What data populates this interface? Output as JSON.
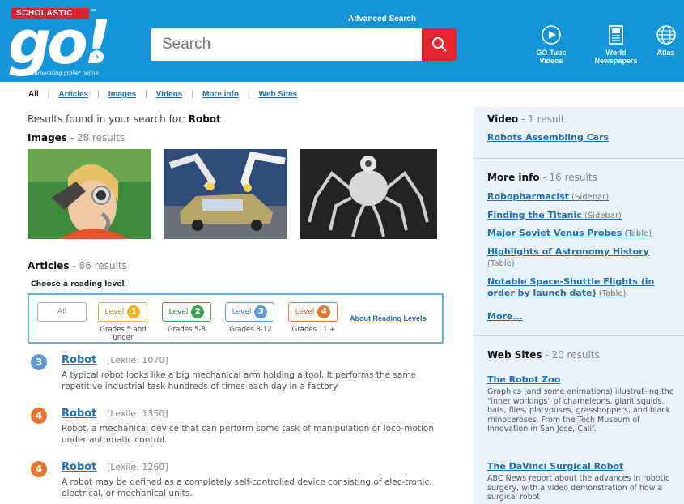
{
  "header": {
    "brand": "SCHOLASTIC",
    "logo": "go!",
    "tagline": "incorporating grolier online",
    "advanced_search": "Advanced Search",
    "search_placeholder": "Search",
    "tools": [
      {
        "icon": "play-circle-icon",
        "label_line1": "GO Tube",
        "label_line2": "Videos"
      },
      {
        "icon": "newspaper-icon",
        "label_line1": "World",
        "label_line2": "Newspapers"
      },
      {
        "icon": "globe-icon",
        "label_line1": "Atlas",
        "label_line2": ""
      }
    ]
  },
  "filters": [
    "All",
    "Articles",
    "Images",
    "Videos",
    "More info",
    "Web Sites"
  ],
  "results": {
    "prefix": "Results found in your search for: ",
    "query": "Robot"
  },
  "images": {
    "heading": "Images",
    "count": " - 28 results"
  },
  "articles": {
    "heading": "Articles",
    "count": " - 86 results",
    "choose_level": "Choose a reading level",
    "all_label": "All",
    "levels": [
      {
        "label": "Level",
        "num": "1",
        "grades": "Grades 5 and under",
        "color": "#f0b21f"
      },
      {
        "label": "Level",
        "num": "2",
        "grades": "Grades 5-8",
        "color": "#3aa548"
      },
      {
        "label": "Level",
        "num": "3",
        "grades": "Grades 8-12",
        "color": "#5b9ad6"
      },
      {
        "label": "Level",
        "num": "4",
        "grades": "Grades 11 +",
        "color": "#e6772d"
      }
    ],
    "about_levels": "About Reading Levels",
    "items": [
      {
        "level": "3",
        "color": "#5b9ad6",
        "title": "Robot",
        "lexile": "[Lexile: 1070]",
        "desc": "A typical robot looks like a big mechanical arm holding a tool. It performs the same repetitive industrial task hundreds of times each day in a factory."
      },
      {
        "level": "4",
        "color": "#e6772d",
        "title": "Robot",
        "lexile": "[Lexile: 1350]",
        "desc": "Robot, a mechanical device that can perform some task of manipulation or loco-motion under automatic control."
      },
      {
        "level": "4",
        "color": "#e6772d",
        "title": "Robot",
        "lexile": "[Lexile: 1260]",
        "desc": "A robot may be defined as a completely self-controlled device consisting of elec-tronic, electrical, or mechanical units."
      }
    ]
  },
  "sidebar": {
    "video": {
      "heading": "Video",
      "count": " - 1 result",
      "items": [
        {
          "title": "Robots Assembling Cars"
        }
      ]
    },
    "more_info": {
      "heading": "More info",
      "count": " - 16 results",
      "items": [
        {
          "title": "Robopharmacist",
          "note": " (Sidebar)"
        },
        {
          "title": "Finding the Titanic",
          "note": " (Sidebar)"
        },
        {
          "title": "Major Soviet Venus Probes",
          "note": " (Table)"
        },
        {
          "title": "Highlights of Astronomy History",
          "note": "(Table)"
        },
        {
          "title": "Notable Space-Shuttle Flights (in order by launch date)",
          "note": " (Table)"
        }
      ],
      "more": "More..."
    },
    "web_sites": {
      "heading": "Web Sites",
      "count": " - 20 results",
      "items": [
        {
          "title": "The Robot Zoo",
          "desc": "Graphics (and some animations) illustrat-ing the \"inner workings\" of chameleons, giant squids, bats, flies, platypuses, grasshoppers, and black rhinoceroses. From the Tech Museum of Innovation in San Jose, Calif."
        },
        {
          "title": "The DaVinci Surgical Robot",
          "desc": "ABC News report about the advances in robotic surgery, with a video demonstration of how a surgical robot"
        }
      ]
    }
  }
}
